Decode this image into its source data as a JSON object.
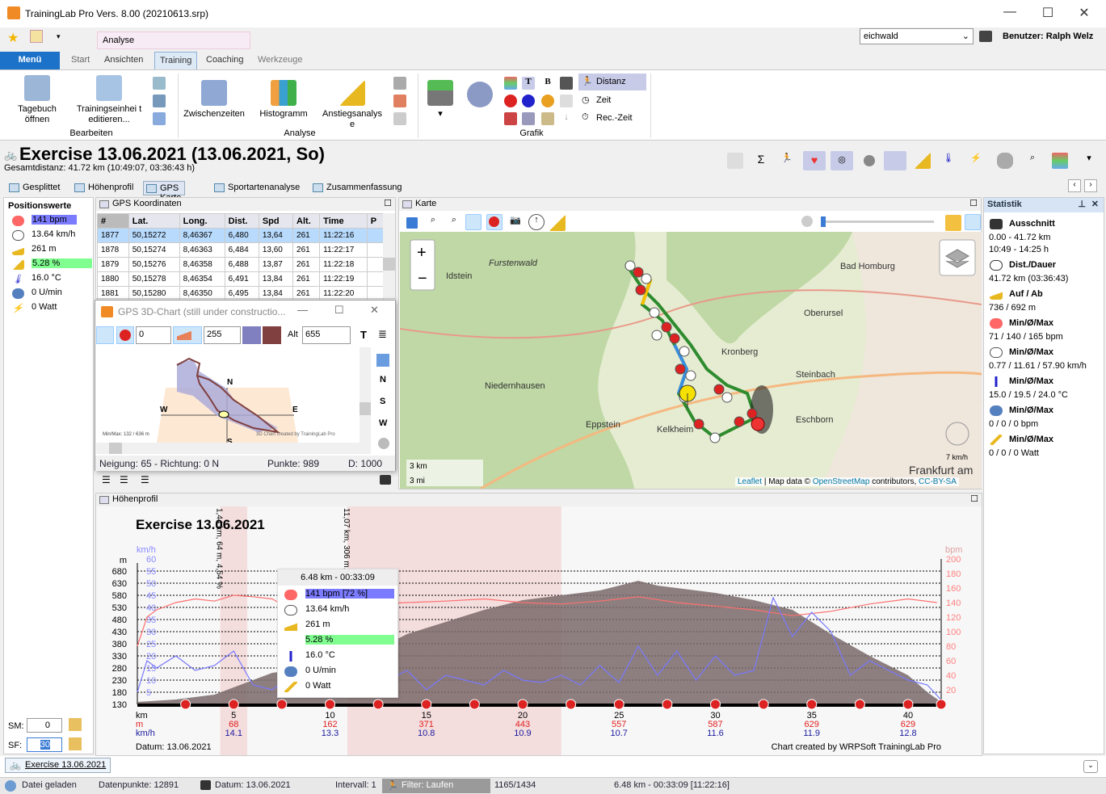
{
  "window": {
    "title": "TrainingLab Pro Vers. 8.00 (20210613.srp)",
    "minimize": "—",
    "maximize": "☐",
    "close": "✕"
  },
  "top_right": {
    "profile_select": "eichwald",
    "user_label": "Benutzer: Ralph Welz"
  },
  "ribbon": {
    "context_tab": "Analyse",
    "tabs": [
      "Menü",
      "Start",
      "Ansichten",
      "Training",
      "Coaching",
      "Werkzeuge"
    ],
    "selected_tab": "Training",
    "groups": {
      "bearbeiten": "Bearbeiten",
      "analyse": "Analyse",
      "grafik": "Grafik"
    },
    "buttons": {
      "tagebuch": "Tagebuch öffnen",
      "trainingseinheit": "Trainingseinhei t editieren...",
      "zwischenzeiten": "Zwischenzeiten",
      "histogramm": "Histogramm",
      "anstieg": "Anstiegsanalys e",
      "distanz": "Distanz",
      "zeit": "Zeit",
      "reczeit": "Rec.-Zeit",
      "t_btn": "T",
      "b_btn": "B"
    }
  },
  "exercise": {
    "title": "Exercise 13.06.2021 (13.06.2021, So)",
    "subtitle": "Gesamtdistanz: 41.72 km (10:49:07, 03:36:43 h)"
  },
  "view_tabs": [
    "Gesplittet",
    "Höhenprofil",
    "GPS Karte",
    "Sportartenanalyse",
    "Zusammenfassung"
  ],
  "selected_view_tab": "GPS Karte",
  "position_values": {
    "title": "Positionswerte",
    "items": [
      {
        "icon": "heart-icon",
        "value": "141 bpm",
        "highlight": "#7b7bff"
      },
      {
        "icon": "speedometer-icon",
        "value": "13.64 km/h"
      },
      {
        "icon": "altitude-icon",
        "value": "261 m"
      },
      {
        "icon": "gradient-icon",
        "value": "5.28 %",
        "highlight": "#80ff90"
      },
      {
        "icon": "thermometer-icon",
        "value": "16.0 °C"
      },
      {
        "icon": "cadence-icon",
        "value": "0 U/min"
      },
      {
        "icon": "power-icon",
        "value": "0 Watt"
      }
    ]
  },
  "smoothing": {
    "sm_label": "SM:",
    "sm_value": "0",
    "sf_label": "SF:",
    "sf_value": "30"
  },
  "gps_table": {
    "title": "GPS Koordinaten",
    "columns": [
      "#",
      "Lat.",
      "Long.",
      "Dist.",
      "Spd",
      "Alt.",
      "Time",
      "P"
    ],
    "rows": [
      [
        "1877",
        "50,15272",
        "8,46367",
        "6,480",
        "13,64",
        "261",
        "11:22:16"
      ],
      [
        "1878",
        "50,15274",
        "8,46363",
        "6,484",
        "13,60",
        "261",
        "11:22:17"
      ],
      [
        "1879",
        "50,15276",
        "8,46358",
        "6,488",
        "13,87",
        "261",
        "11:22:18"
      ],
      [
        "1880",
        "50,15278",
        "8,46354",
        "6,491",
        "13,84",
        "261",
        "11:22:19"
      ],
      [
        "1881",
        "50,15280",
        "8,46350",
        "6,495",
        "13,84",
        "261",
        "11:22:20"
      ]
    ]
  },
  "chart3d": {
    "title": "GPS 3D-Chart (still under constructio...",
    "field1": "0",
    "field2": "255",
    "alt_label": "Alt",
    "alt_value": "655",
    "color1": "#8080c0",
    "color2": "#804040",
    "minmax": "Min/Max: 132 / 636 m",
    "credit": "3D Chart created by TrainingLab Pro",
    "dirs": {
      "n": "N",
      "s": "S",
      "e": "E",
      "w": "W"
    },
    "side_buttons": [
      "N",
      "S",
      "W"
    ],
    "status": {
      "neigung": "Neigung: 65 - Richtung: 0 N",
      "punkte": "Punkte: 989",
      "d": "D: 1000"
    }
  },
  "map": {
    "title": "Karte",
    "zoom_in": "+",
    "zoom_out": "−",
    "scale_km": "3 km",
    "scale_mi": "3 mi",
    "compass_speed": "7 km/h",
    "places": [
      "Furstenwald",
      "Idstein",
      "Bad Homburg",
      "Oberursel",
      "Kronberg",
      "Niedernhausen",
      "Steinbach",
      "Eppstein",
      "Kelkheim",
      "Eschborn",
      "Frankfurt am"
    ],
    "attribution_leaflet": "Leaflet",
    "attribution_text": "| Map data ©",
    "attribution_osm": "OpenStreetMap",
    "attribution_contrib": "contributors,",
    "attribution_license": "CC-BY-SA"
  },
  "statistik": {
    "title": "Statistik",
    "items": [
      {
        "icon": "flag-icon",
        "label": "Ausschnitt",
        "values": [
          "0.00 - 41.72 km",
          "10:49 - 14:25 h"
        ]
      },
      {
        "icon": "stopwatch-icon",
        "label": "Dist./Dauer",
        "values": [
          "41.72 km (03:36:43)"
        ]
      },
      {
        "icon": "altitude-icon",
        "label": "Auf / Ab",
        "values": [
          "736 / 692 m"
        ]
      },
      {
        "icon": "heart-icon",
        "label": "Min/Ø/Max",
        "values": [
          "71 / 140 / 165 bpm"
        ]
      },
      {
        "icon": "speedometer-icon",
        "label": "Min/Ø/Max",
        "values": [
          "0.77 / 11.61 / 57.90 km/h"
        ]
      },
      {
        "icon": "thermometer-icon",
        "label": "Min/Ø/Max",
        "values": [
          "15.0 / 19.5 / 24.0 °C"
        ]
      },
      {
        "icon": "cadence-icon",
        "label": "Min/Ø/Max",
        "values": [
          "0 / 0 / 0 bpm"
        ]
      },
      {
        "icon": "power-icon",
        "label": "Min/Ø/Max",
        "values": [
          "0 / 0 / 0 Watt"
        ]
      }
    ]
  },
  "profile": {
    "panel_title": "Höhenprofil",
    "chart_title": "Exercise 13.06.2021",
    "date": "Datum: 13.06.2021",
    "credit": "Chart created by WRPSoft TrainingLab Pro",
    "band_labels": [
      "1,44 km, 64 m, 4,54 %",
      "11,07 km, 306 m,"
    ],
    "tooltip": {
      "header": "6.48 km - 00:33:09",
      "items": [
        "141 bpm [72 %]",
        "13.64 km/h",
        "261 m",
        "5.28 %",
        "16.0 °C",
        "0 U/min",
        "0 Watt"
      ]
    }
  },
  "chart_data": {
    "type": "line",
    "title": "Exercise 13.06.2021",
    "x_unit": "km",
    "xlim": [
      0,
      41.72
    ],
    "y_left": {
      "unit": "m",
      "ticks": [
        130,
        180,
        230,
        280,
        330,
        380,
        430,
        480,
        530,
        580,
        630,
        680
      ]
    },
    "y_speed": {
      "unit": "km/h",
      "ticks": [
        5,
        10,
        15,
        20,
        25,
        30,
        35,
        40,
        45,
        50,
        55,
        60
      ]
    },
    "y_right": {
      "unit": "bpm",
      "ticks": [
        20,
        40,
        60,
        80,
        100,
        120,
        140,
        160,
        180,
        200
      ]
    },
    "grid": true,
    "footer_rows": {
      "labels": [
        "km",
        "m",
        "km/h"
      ],
      "km": [
        5,
        10,
        15,
        20,
        25,
        30,
        35,
        40
      ],
      "m": [
        68,
        162,
        371,
        443,
        557,
        587,
        629,
        629
      ],
      "kmh": [
        14.1,
        13.3,
        10.8,
        10.9,
        10.7,
        11.6,
        11.9,
        12.8
      ]
    },
    "highlight_bands_km": [
      [
        4.3,
        5.7
      ],
      [
        10.9,
        22.0
      ]
    ],
    "lap_markers_km": [
      2.5,
      5,
      7.5,
      10,
      12.5,
      15,
      17.5,
      20,
      22.5,
      25,
      27.5,
      30,
      32.5,
      35,
      37.5,
      40,
      41.72
    ],
    "series": [
      {
        "unit": "m",
        "color": "#7a6a6a",
        "x": [
          0,
          2,
          4,
          5,
          6,
          7,
          8,
          10,
          12,
          13,
          14,
          16,
          18,
          20,
          22,
          24,
          26,
          27,
          28,
          30,
          32,
          34,
          35,
          36,
          38,
          40,
          41,
          41.72
        ],
        "y": [
          140,
          150,
          170,
          200,
          230,
          260,
          270,
          300,
          330,
          380,
          420,
          470,
          520,
          560,
          580,
          600,
          640,
          620,
          610,
          590,
          560,
          520,
          470,
          420,
          330,
          250,
          180,
          140
        ]
      },
      {
        "unit": "bpm",
        "color": "#ff7070",
        "x": [
          0,
          0.5,
          1,
          2,
          3,
          4,
          5,
          6,
          7,
          8,
          9,
          10,
          12,
          14,
          16,
          18,
          20,
          22,
          24,
          26,
          28,
          30,
          32,
          34,
          36,
          38,
          40,
          41.5
        ],
        "y": [
          80,
          120,
          130,
          140,
          145,
          142,
          150,
          148,
          145,
          130,
          132,
          135,
          138,
          140,
          142,
          145,
          140,
          138,
          142,
          148,
          140,
          135,
          130,
          122,
          128,
          138,
          145,
          140
        ]
      },
      {
        "unit": "km/h",
        "color": "#7878ff",
        "x": [
          0,
          0.5,
          1,
          2,
          3,
          4,
          5,
          6,
          7,
          8,
          9,
          10,
          11,
          12,
          13,
          14,
          15,
          16,
          17,
          18,
          19,
          20,
          21,
          22,
          23,
          24,
          25,
          26,
          27,
          28,
          29,
          30,
          31,
          32,
          33,
          34,
          35,
          36,
          37,
          38,
          39,
          40,
          41,
          41.7
        ],
        "y": [
          5,
          18,
          15,
          20,
          14,
          16,
          22,
          8,
          6,
          12,
          10,
          35,
          8,
          12,
          10,
          14,
          6,
          12,
          10,
          8,
          14,
          10,
          9,
          12,
          8,
          16,
          9,
          24,
          12,
          22,
          10,
          20,
          12,
          14,
          44,
          28,
          38,
          30,
          12,
          18,
          14,
          10,
          8,
          2
        ]
      }
    ]
  },
  "status": {
    "geladen": "Datei geladen",
    "punkte": "Datenpunkte: 12891",
    "datum": "Datum: 13.06.2021",
    "intervall": "Intervall: 1",
    "filter": "Filter: Laufen",
    "count": "1165/1434",
    "pos": "6.48 km - 00:33:09 [11:22:16]"
  },
  "bottom_tab": "Exercise 13.06.2021"
}
